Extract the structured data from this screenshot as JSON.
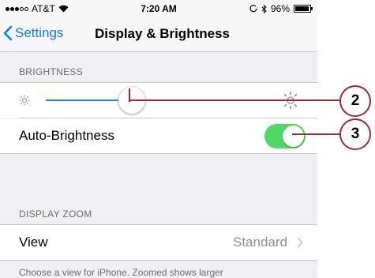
{
  "status_bar": {
    "carrier": "AT&T",
    "time": "7:20 AM",
    "battery_percent": "96%",
    "battery_level": 0.96
  },
  "nav": {
    "back_label": "Settings",
    "title": "Display & Brightness"
  },
  "brightness": {
    "section_header": "BRIGHTNESS",
    "slider_value": 0.38,
    "auto_label": "Auto-Brightness",
    "auto_on": true
  },
  "zoom": {
    "section_header": "DISPLAY ZOOM",
    "view_label": "View",
    "view_value": "Standard",
    "footer": "Choose a view for iPhone. Zoomed shows larger"
  },
  "callouts": [
    "2",
    "3"
  ],
  "colors": {
    "accent": "#0a7aff",
    "toggle_on": "#4cd964",
    "callout": "#9c2a3a"
  }
}
